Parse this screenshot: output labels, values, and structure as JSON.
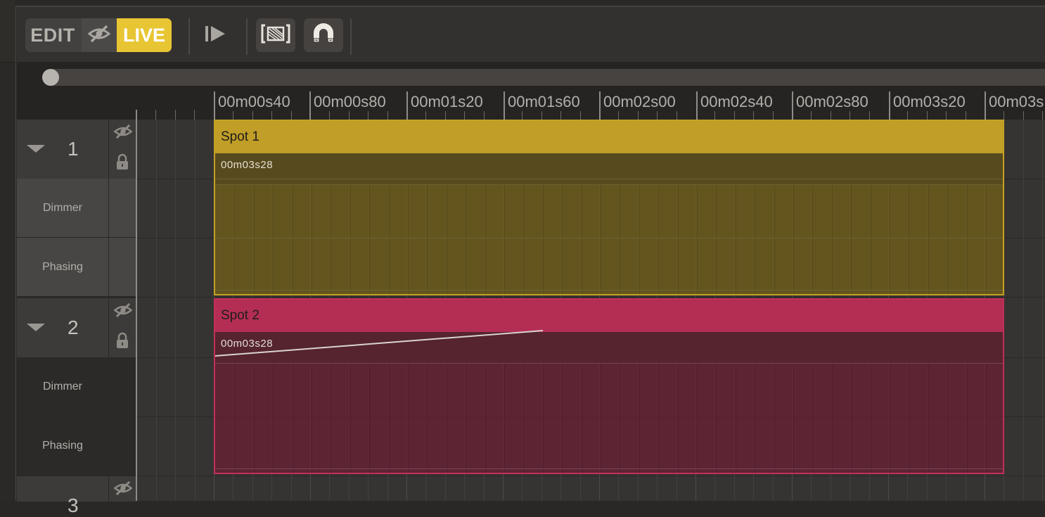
{
  "toolbar": {
    "edit_label": "EDIT",
    "live_label": "LIVE",
    "live_color": "#e8c533",
    "icons": [
      "eye-off-icon",
      "play-from-start-icon",
      "zoom-fit-icon",
      "magnet-icon"
    ]
  },
  "scroll": {
    "position_fraction": 0.0
  },
  "ruler": {
    "labels": [
      "00m00s40",
      "00m00s80",
      "00m01s20",
      "00m01s60",
      "00m02s00",
      "00m02s40",
      "00m02s80",
      "00m03s20",
      "00m03s"
    ]
  },
  "tracks": [
    {
      "number": "1",
      "params": [
        "Dimmer",
        "Phasing"
      ],
      "clip": {
        "title": "Spot 1",
        "duration": "00m03s28",
        "color": "#c09e27"
      }
    },
    {
      "number": "2",
      "params": [
        "Dimmer",
        "Phasing"
      ],
      "clip": {
        "title": "Spot 2",
        "duration": "00m03s28",
        "color": "#b42e53"
      }
    },
    {
      "number": "3"
    }
  ]
}
